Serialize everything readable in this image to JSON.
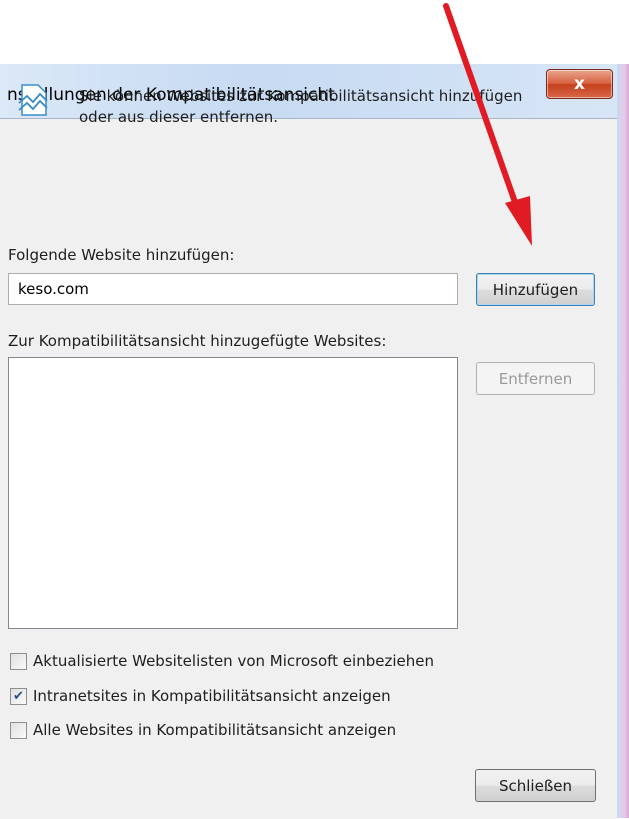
{
  "dialog": {
    "title": "nstellungen der Kompatibilitätsansicht",
    "close_label": "x"
  },
  "info": {
    "icon": "compatibility-view-icon",
    "line1": "Sie können Websites zur Kompatibilitätsansicht hinzufügen",
    "line2": "oder aus dieser entfernen."
  },
  "add_site": {
    "label": "Folgende Website hinzufügen:",
    "value": "keso.com",
    "button": "Hinzufügen"
  },
  "list": {
    "label": "Zur Kompatibilitätsansicht hinzugefügte Websites:",
    "items": [],
    "remove_button": "Entfernen"
  },
  "options": [
    {
      "label": "Aktualisierte Websitelisten von Microsoft einbeziehen",
      "checked": false
    },
    {
      "label": "Intranetsites in Kompatibilitätsansicht anzeigen",
      "checked": true
    },
    {
      "label": "Alle Websites in Kompatibilitätsansicht anzeigen",
      "checked": false
    }
  ],
  "close_button": "Schließen",
  "colors": {
    "annotation_arrow": "#e01b24",
    "close_button": "#c4401c"
  }
}
